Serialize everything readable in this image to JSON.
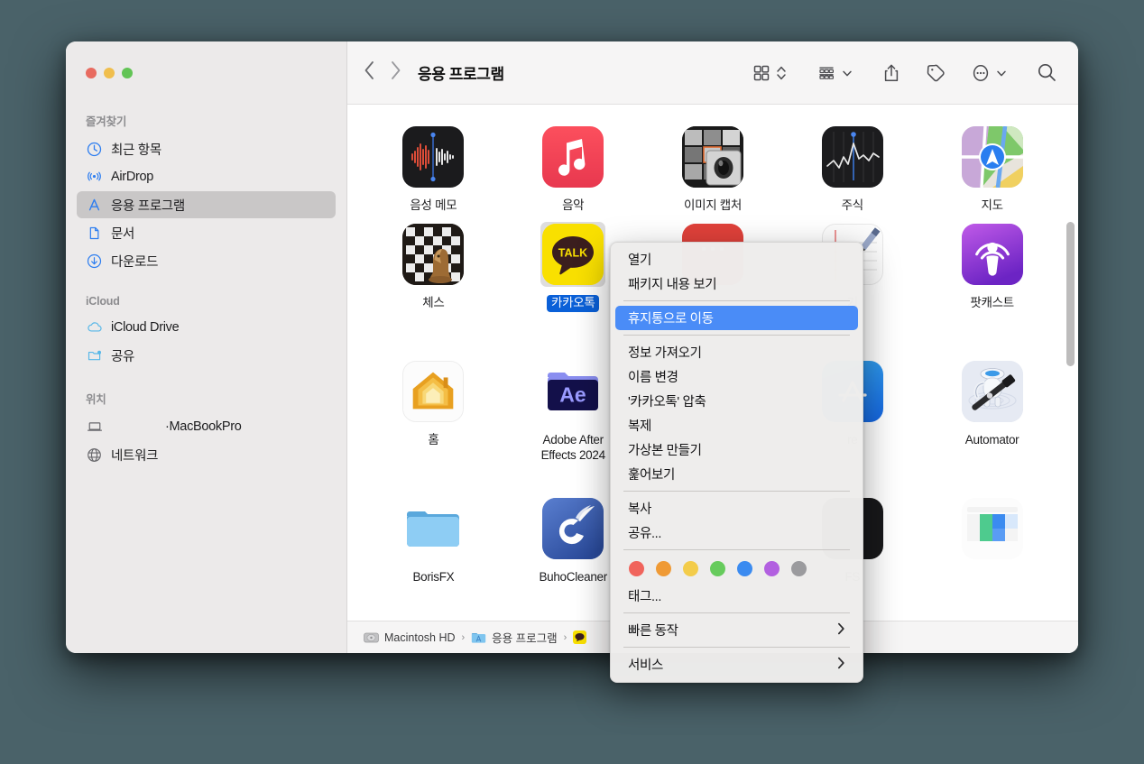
{
  "window": {
    "traffic_lights": [
      "close",
      "minimize",
      "zoom"
    ]
  },
  "sidebar": {
    "sections": [
      {
        "title": "즐겨찾기",
        "items": [
          {
            "label": "최근 항목",
            "icon": "clock-icon",
            "active": false
          },
          {
            "label": "AirDrop",
            "icon": "airdrop-icon",
            "active": false
          },
          {
            "label": "응용 프로그램",
            "icon": "applications-icon",
            "active": true
          },
          {
            "label": "문서",
            "icon": "document-icon",
            "active": false
          },
          {
            "label": "다운로드",
            "icon": "download-icon",
            "active": false
          }
        ]
      },
      {
        "title": "iCloud",
        "items": [
          {
            "label": "iCloud Drive",
            "icon": "cloud-icon",
            "active": false
          },
          {
            "label": "공유",
            "icon": "shared-folder-icon",
            "active": false
          }
        ]
      },
      {
        "title": "위치",
        "items": [
          {
            "label": "·MacBookPro",
            "icon": "laptop-icon",
            "active": false
          },
          {
            "label": "네트워크",
            "icon": "globe-icon",
            "active": false
          }
        ]
      }
    ]
  },
  "toolbar": {
    "back_label": "뒤로",
    "forward_label": "앞으로",
    "title": "응용 프로그램",
    "buttons": [
      {
        "name": "view-mode-grid",
        "label": "보기 방식"
      },
      {
        "name": "group-by",
        "label": "정렬 및 그룹"
      },
      {
        "name": "share",
        "label": "공유"
      },
      {
        "name": "tag",
        "label": "태그"
      },
      {
        "name": "more-actions",
        "label": "더 보기"
      },
      {
        "name": "search",
        "label": "검색"
      }
    ]
  },
  "grid": {
    "rows": [
      [
        {
          "label": "음성 메모",
          "icon": "voice-memos-app-icon",
          "selected": false
        },
        {
          "label": "음악",
          "icon": "music-app-icon",
          "selected": false
        },
        {
          "label": "이미지 캡처",
          "icon": "image-capture-app-icon",
          "selected": false
        },
        {
          "label": "주식",
          "icon": "stocks-app-icon",
          "selected": false
        },
        {
          "label": "지도",
          "icon": "maps-app-icon",
          "selected": false
        }
      ],
      [
        {
          "label": "체스",
          "icon": "chess-app-icon",
          "selected": false
        },
        {
          "label": "카카오톡",
          "icon": "kakaotalk-app-icon",
          "selected": true
        },
        {
          "label": "",
          "icon": "hidden-red-app-icon",
          "selected": false
        },
        {
          "label": "기",
          "icon": "hidden-notes-app-icon",
          "selected": false
        },
        {
          "label": "팟캐스트",
          "icon": "podcasts-app-icon",
          "selected": false
        }
      ],
      [
        {
          "label": "홈",
          "icon": "home-app-icon",
          "selected": false
        },
        {
          "label": "Adobe After Effects 2024",
          "icon": "after-effects-folder-icon",
          "selected": false
        },
        {
          "label": "",
          "icon": "hidden-app-icon",
          "selected": false
        },
        {
          "label": "re",
          "icon": "app-store-app-icon",
          "selected": false
        },
        {
          "label": "Automator",
          "icon": "automator-app-icon",
          "selected": false
        }
      ],
      [
        {
          "label": "BorisFX",
          "icon": "folder-icon",
          "selected": false
        },
        {
          "label": "BuhoCleaner",
          "icon": "buhocleaner-app-icon",
          "selected": false
        },
        {
          "label": "",
          "icon": "hidden-app-icon",
          "selected": false
        },
        {
          "label": "FS",
          "icon": "hidden-dark-app-icon",
          "selected": false
        },
        {
          "label": "",
          "icon": "numbers-app-icon",
          "selected": false
        }
      ]
    ]
  },
  "pathbar": {
    "items": [
      {
        "label": "Macintosh HD",
        "icon": "hard-disk-icon"
      },
      {
        "label": "응용 프로그램",
        "icon": "applications-folder-icon"
      },
      {
        "label": "",
        "icon": "kakaotalk-app-icon"
      }
    ],
    "separator": "›"
  },
  "context_menu": {
    "groups": [
      {
        "items": [
          {
            "label": "열기",
            "highlighted": false,
            "submenu": false
          },
          {
            "label": "패키지 내용 보기",
            "highlighted": false,
            "submenu": false
          }
        ]
      },
      {
        "items": [
          {
            "label": "휴지통으로 이동",
            "highlighted": true,
            "submenu": false
          }
        ]
      },
      {
        "items": [
          {
            "label": "정보 가져오기",
            "highlighted": false,
            "submenu": false
          },
          {
            "label": "이름 변경",
            "highlighted": false,
            "submenu": false
          },
          {
            "label": "'카카오톡' 압축",
            "highlighted": false,
            "submenu": false
          },
          {
            "label": "복제",
            "highlighted": false,
            "submenu": false
          },
          {
            "label": "가상본 만들기",
            "highlighted": false,
            "submenu": false
          },
          {
            "label": "훑어보기",
            "highlighted": false,
            "submenu": false
          }
        ]
      },
      {
        "items": [
          {
            "label": "복사",
            "highlighted": false,
            "submenu": false
          },
          {
            "label": "공유...",
            "highlighted": false,
            "submenu": false
          }
        ]
      },
      {
        "tags": [
          "#f0645c",
          "#ef9a35",
          "#f3cc4a",
          "#66cb5c",
          "#3b8bf0",
          "#b260e0",
          "#9b9b9e"
        ]
      },
      {
        "items": [
          {
            "label": "태그...",
            "highlighted": false,
            "submenu": false
          }
        ]
      },
      {
        "items": [
          {
            "label": "빠른 동작",
            "highlighted": false,
            "submenu": true
          }
        ]
      },
      {
        "items": [
          {
            "label": "서비스",
            "highlighted": false,
            "submenu": true
          }
        ]
      }
    ],
    "submenu_arrow": "›",
    "highlight_color": "#4a8cf7"
  },
  "colors": {
    "desktop_background": "#4a6269",
    "sidebar_background": "#eceaea",
    "selection_blue": "#0a60d8",
    "menu_highlight": "#4a8cf7"
  }
}
